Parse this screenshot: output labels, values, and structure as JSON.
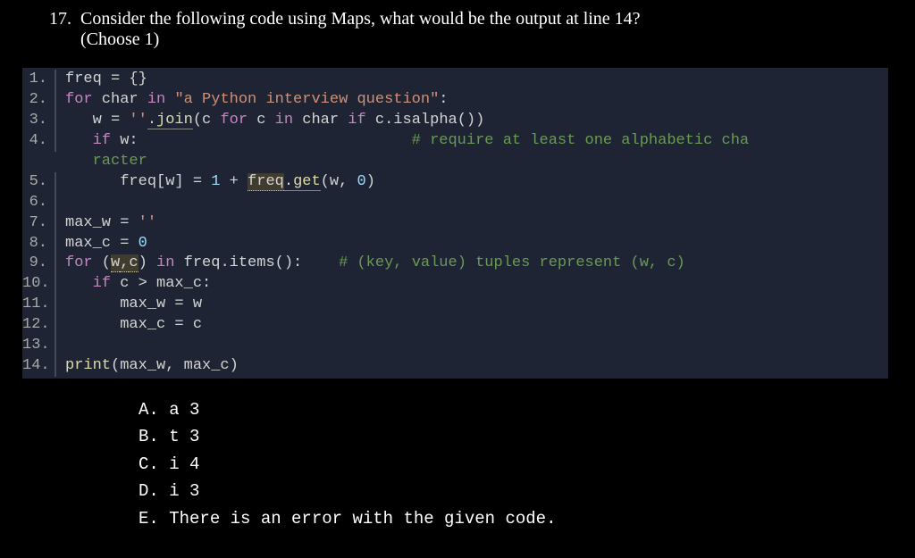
{
  "question": {
    "number": "17.",
    "text": "Consider the following code using Maps, what would be the output at line 14?",
    "instruction": "(Choose 1)"
  },
  "code": {
    "lines": [
      {
        "n": "1.",
        "segments": [
          {
            "t": "freq ",
            "c": "plain"
          },
          {
            "t": "=",
            "c": "plain"
          },
          {
            "t": " {}",
            "c": "plain"
          }
        ]
      },
      {
        "n": "2.",
        "segments": [
          {
            "t": "for",
            "c": "kw"
          },
          {
            "t": " char ",
            "c": "plain"
          },
          {
            "t": "in",
            "c": "kw"
          },
          {
            "t": " ",
            "c": "plain"
          },
          {
            "t": "\"a Python interview question\"",
            "c": "str"
          },
          {
            "t": ":",
            "c": "plain"
          }
        ]
      },
      {
        "n": "3.",
        "segments": [
          {
            "t": "   w ",
            "c": "plain"
          },
          {
            "t": "=",
            "c": "plain"
          },
          {
            "t": " ",
            "c": "plain"
          },
          {
            "t": "''",
            "c": "str"
          },
          {
            "t": ".",
            "c": "plain",
            "h": "highlight"
          },
          {
            "t": "join",
            "c": "func",
            "h": "highlight"
          },
          {
            "t": "(c ",
            "c": "plain"
          },
          {
            "t": "for",
            "c": "kw"
          },
          {
            "t": " c ",
            "c": "plain"
          },
          {
            "t": "in",
            "c": "kw"
          },
          {
            "t": " char ",
            "c": "plain"
          },
          {
            "t": "if",
            "c": "kw"
          },
          {
            "t": " c.isalpha())",
            "c": "plain"
          }
        ]
      },
      {
        "n": "4.",
        "segments": [
          {
            "t": "   ",
            "c": "plain"
          },
          {
            "t": "if",
            "c": "kw"
          },
          {
            "t": " w:                              ",
            "c": "plain"
          },
          {
            "t": "# require at least one alphabetic cha",
            "c": "comment"
          }
        ]
      },
      {
        "n": "",
        "segments": [
          {
            "t": "   ",
            "c": "plain"
          },
          {
            "t": "racter",
            "c": "comment"
          }
        ]
      },
      {
        "n": "5.",
        "segments": [
          {
            "t": "      freq[w] ",
            "c": "plain"
          },
          {
            "t": "=",
            "c": "plain"
          },
          {
            "t": " ",
            "c": "plain"
          },
          {
            "t": "1",
            "c": "num"
          },
          {
            "t": " ",
            "c": "plain"
          },
          {
            "t": "+",
            "c": "plain"
          },
          {
            "t": " ",
            "c": "plain"
          },
          {
            "t": "freq",
            "c": "plain",
            "h": "highlight-strong"
          },
          {
            "t": ".",
            "c": "plain",
            "h": "highlight"
          },
          {
            "t": "get",
            "c": "func",
            "h": "highlight"
          },
          {
            "t": "(w, ",
            "c": "plain"
          },
          {
            "t": "0",
            "c": "num"
          },
          {
            "t": ")",
            "c": "plain"
          }
        ]
      },
      {
        "n": "6.",
        "segments": []
      },
      {
        "n": "7.",
        "segments": [
          {
            "t": "max_w ",
            "c": "plain"
          },
          {
            "t": "=",
            "c": "plain"
          },
          {
            "t": " ",
            "c": "plain"
          },
          {
            "t": "''",
            "c": "str"
          }
        ]
      },
      {
        "n": "8.",
        "segments": [
          {
            "t": "max_c ",
            "c": "plain"
          },
          {
            "t": "=",
            "c": "plain"
          },
          {
            "t": " ",
            "c": "plain"
          },
          {
            "t": "0",
            "c": "num"
          }
        ]
      },
      {
        "n": "9.",
        "segments": [
          {
            "t": "for",
            "c": "kw"
          },
          {
            "t": " (",
            "c": "plain"
          },
          {
            "t": "w",
            "c": "plain",
            "h": "highlight-strong"
          },
          {
            "t": ",",
            "c": "plain",
            "h": "highlight-strong"
          },
          {
            "t": "c",
            "c": "plain",
            "h": "highlight-strong"
          },
          {
            "t": ") ",
            "c": "plain"
          },
          {
            "t": "in",
            "c": "kw"
          },
          {
            "t": " freq.items():    ",
            "c": "plain"
          },
          {
            "t": "# (key, value) tuples represent (w, c)",
            "c": "comment"
          }
        ]
      },
      {
        "n": "10.",
        "segments": [
          {
            "t": "   ",
            "c": "plain"
          },
          {
            "t": "if",
            "c": "kw"
          },
          {
            "t": " c ",
            "c": "plain"
          },
          {
            "t": ">",
            "c": "plain"
          },
          {
            "t": " max_c:",
            "c": "plain"
          }
        ]
      },
      {
        "n": "11.",
        "segments": [
          {
            "t": "      max_w ",
            "c": "plain"
          },
          {
            "t": "=",
            "c": "plain"
          },
          {
            "t": " w",
            "c": "plain"
          }
        ]
      },
      {
        "n": "12.",
        "segments": [
          {
            "t": "      max_c ",
            "c": "plain"
          },
          {
            "t": "=",
            "c": "plain"
          },
          {
            "t": " c",
            "c": "plain"
          }
        ]
      },
      {
        "n": "13.",
        "segments": []
      },
      {
        "n": "14.",
        "segments": [
          {
            "t": "print",
            "c": "func"
          },
          {
            "t": "(max_w, max_c)",
            "c": "plain"
          }
        ]
      }
    ]
  },
  "options": [
    {
      "label": "A.",
      "text": "a 3"
    },
    {
      "label": "B.",
      "text": "t 3"
    },
    {
      "label": "C.",
      "text": "i 4"
    },
    {
      "label": "D.",
      "text": "i 3"
    },
    {
      "label": "E.",
      "text": "There is an error with the given code."
    }
  ]
}
